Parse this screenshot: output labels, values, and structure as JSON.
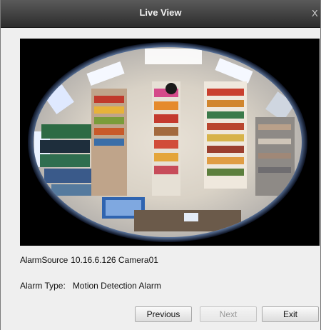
{
  "window": {
    "title": "Live View",
    "close_glyph": "X"
  },
  "video": {
    "description_icon": "fisheye-camera-feed"
  },
  "alarm": {
    "source_label": "AlarmSource",
    "source_value": "10.16.6.126 Camera01",
    "type_label": "Alarm Type:",
    "type_value": "Motion Detection Alarm"
  },
  "buttons": {
    "previous": "Previous",
    "next": "Next",
    "exit": "Exit"
  },
  "colors": {
    "titlebar": "#3a3a3a",
    "dialog_bg": "#efefef",
    "disabled_text": "#9a9a9a"
  }
}
